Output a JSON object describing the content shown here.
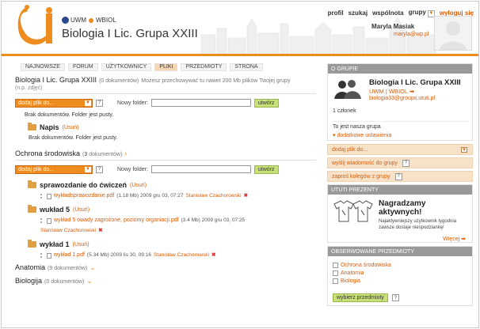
{
  "header": {
    "university": "UWM",
    "faculty": "WBIOL",
    "group_title": "Biologia I Lic. Grupa XXIII",
    "nav": [
      "profil",
      "szukaj",
      "wspólnota",
      "grupy"
    ],
    "logout": "wyloguj się",
    "user_name": "Maryla Masiak",
    "user_email": "maryla@wp.pl"
  },
  "tabs": [
    {
      "label": "NAJNOWSZE",
      "active": false
    },
    {
      "label": "FORUM",
      "active": false
    },
    {
      "label": "UŻYTKOWNICY",
      "active": false
    },
    {
      "label": "PLIKI",
      "active": true
    },
    {
      "label": "PRZEDMIOTY",
      "active": false
    },
    {
      "label": "STRONA",
      "active": false
    }
  ],
  "main": {
    "group_section": {
      "title": "Biologia I Lic. Grupa XXIII",
      "count": "(0 dokumentów)",
      "note": "Możesz przechowywać tu nawet 200 Mb plików Twojej grupy",
      "sub_note": "(n.p. zdjęć)"
    },
    "add_file_label": "dodaj plik do...",
    "new_folder_label": "Nowy folder:",
    "create_label": "utwórz",
    "empty_text": "Brak dokumentów. Folder jest pusty.",
    "napis_folder": {
      "name": "Napis",
      "delete": "(Usuń)",
      "empty": "Brak dokumentów. Folder jest pusty."
    },
    "ochrona": {
      "title": "Ochrona środowiska",
      "count_num": "3",
      "count_word": "dokumentów"
    },
    "folders": [
      {
        "name": "sprawozdanie do ćwiczeń",
        "delete": "(Usuń)",
        "file": "wykładsprawozdanie.pdf",
        "meta": "(1.18 Mb) 2009 gru 03, 07:27",
        "author": "Stanisław Czachorowski"
      },
      {
        "name": "wukład 5",
        "delete": "(Usuń)",
        "file": "wykład 5 owady zagrożone, poziomy organiacji.pdf",
        "meta": "(3.4 Mb) 2009 gru 03, 07:25",
        "author": "Stanisław Czachorowski"
      },
      {
        "name": "wykład 1",
        "delete": "(Usuń)",
        "file": "wykład 1.pdf",
        "meta": "(5.34 Mb) 2009 lis 30, 09:16",
        "author": "Stanisław Czachorowski"
      }
    ],
    "anatomia": {
      "title": "Anatomia",
      "count": "(9 dokumentów)"
    },
    "biologia": {
      "title": "Biologija",
      "count": "(0 dokumentów)"
    }
  },
  "sidebar": {
    "about_head": "O GRUPIE",
    "group_name": "Biologia I Lic. Grupa XXIII",
    "group_uni": "UWM | WBIOL",
    "group_mail": "biologia33@groups.ututi.pl",
    "members": "1 członek",
    "description": "To jest nasza grupa",
    "more": "dodatkowe ustawienia",
    "add_file": "dodaj plik do...",
    "send_message": "wyślij wiadomość do grupy",
    "invite": "zaproś kolegów z grupy",
    "prizes_head": "UTUTI PREZENTY",
    "prize_title": "Nagradzamy aktywnych!",
    "prize_desc": "Najaktywniejszy użytkownik tygodnia zawsze dostaje niespodziankę!",
    "prize_more": "Więcej",
    "subjects_head": "OBSERWOWANE PRZEDMIOTY",
    "subjects": [
      "Ochrona środowiska",
      "Anatomia",
      "Biologia"
    ],
    "choose_subjects": "wybierz przedmioty"
  },
  "colors": {
    "accent": "#ef8c1f",
    "link": "#e05a00",
    "green": "#c7e07a"
  }
}
